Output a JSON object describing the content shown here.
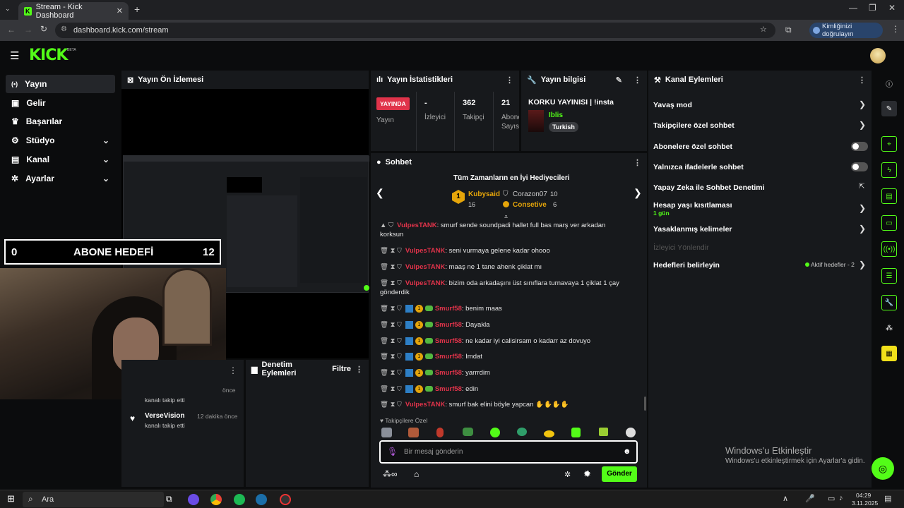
{
  "browser": {
    "tab_title": "Stream - Kick Dashboard",
    "url": "dashboard.kick.com/stream",
    "verify_label": "Kimliğinizi doğrulayın"
  },
  "brand": {
    "logo": "KICK",
    "beta": "BETA",
    "accent": "#53fc18"
  },
  "sidebar": {
    "items": [
      {
        "label": "Yayın",
        "icon": "broadcast-icon"
      },
      {
        "label": "Gelir",
        "icon": "revenue-icon"
      },
      {
        "label": "Başarılar",
        "icon": "trophy-icon"
      },
      {
        "label": "Stüdyo",
        "icon": "studio-icon"
      },
      {
        "label": "Kanal",
        "icon": "channel-icon"
      },
      {
        "label": "Ayarlar",
        "icon": "gear-icon"
      }
    ]
  },
  "preview": {
    "title": "Yayın Ön İzlemesi",
    "goal_label": "ABONE HEDEFİ",
    "goal_current": "0",
    "goal_target": "12"
  },
  "stats": {
    "title": "Yayın İstatistikleri",
    "live_badge": "YAYINDA",
    "live_label": "Yayın",
    "viewers_value": "-",
    "viewers_label": "İzleyici",
    "followers_value": "362",
    "followers_label": "Takipçi",
    "subs_value": "21",
    "subs_label1": "Abone",
    "subs_label2": "Sayısı"
  },
  "info": {
    "title": "Yayın bilgisi",
    "stream_title": "KORKU YAYINISI | !insta",
    "category": "Iblis",
    "language": "Turkish"
  },
  "channel_actions": {
    "title": "Kanal Eylemleri",
    "slow_mode": "Yavaş mod",
    "followers_only": "Takipçilere özel sohbet",
    "subs_only": "Abonelere özel sohbet",
    "emotes_only": "Yalnızca ifadelerle sohbet",
    "ai_moderation": "Yapay Zeka ile Sohbet Denetimi",
    "account_age": "Hesap yaşı kısıtlaması",
    "account_age_value": "1 gün",
    "banned_words": "Yasaklanmış kelimeler",
    "redirect": "İzleyici Yönlendir",
    "goals": "Hedefleri belirleyin",
    "goals_status": "Aktif hedefler - 2"
  },
  "chat": {
    "title": "Sohbet",
    "gifters_title": "Tüm Zamanların en İyi Hediyecileri",
    "top_gifter": {
      "name": "Kubysaid",
      "count": "16",
      "rank": "1"
    },
    "gifter2": {
      "name": "Corazon07",
      "count": "10"
    },
    "gifter3": {
      "name": "Consetive",
      "count": "6"
    },
    "messages": [
      {
        "user": "VulpesTANK",
        "text": ": smurf sende soundpadi hallet full bas marş ver arkadan",
        "cont": "korksun"
      },
      {
        "user": "VulpesTANK",
        "text": ": seni vurmaya gelene kadar ohooo"
      },
      {
        "user": "VulpesTANK",
        "text": ": maaş ne 1 tane ahenk çiklat mı"
      },
      {
        "user": "VulpesTANK",
        "text": ": bizim oda arkadaşını üst sınıflara turnavaya 1 çiklat 1 çay",
        "cont": "gönderdik"
      },
      {
        "user": "Smurf58",
        "text": ": benim maas"
      },
      {
        "user": "Smurf58",
        "text": ": Dayakla"
      },
      {
        "user": "Smurf58",
        "text": ": ne kadar iyi calisirsam o kadarr az dovuyo"
      },
      {
        "user": "Smurf58",
        "text": ": Imdat"
      },
      {
        "user": "Smurf58",
        "text": ": yarrrdim"
      },
      {
        "user": "Smurf58",
        "text": ": edin"
      },
      {
        "user": "VulpesTANK",
        "text": ": smurf bak elini böyle yapcan ✋✋✋✋"
      }
    ],
    "followers_emotes": "Takipçilere Özel",
    "input_placeholder": "Bir mesaj gönderin",
    "send_label": "Gönder"
  },
  "events": {
    "follow1_sub": "kanalı takip etti",
    "follow1_time": "önce",
    "follow2_name": "VerseVision",
    "follow2_sub": "kanalı takip etti",
    "follow2_time": "12 dakika önce"
  },
  "moderation": {
    "title": "Denetim Eylemleri",
    "filter": "Filtre"
  },
  "windows": {
    "activate_title": "Windows'u Etkinleştir",
    "activate_sub": "Windows'u etkinleştirmek için Ayarlar'a gidin.",
    "search": "Ara",
    "time": "04:29",
    "date": "3.11.2025"
  }
}
